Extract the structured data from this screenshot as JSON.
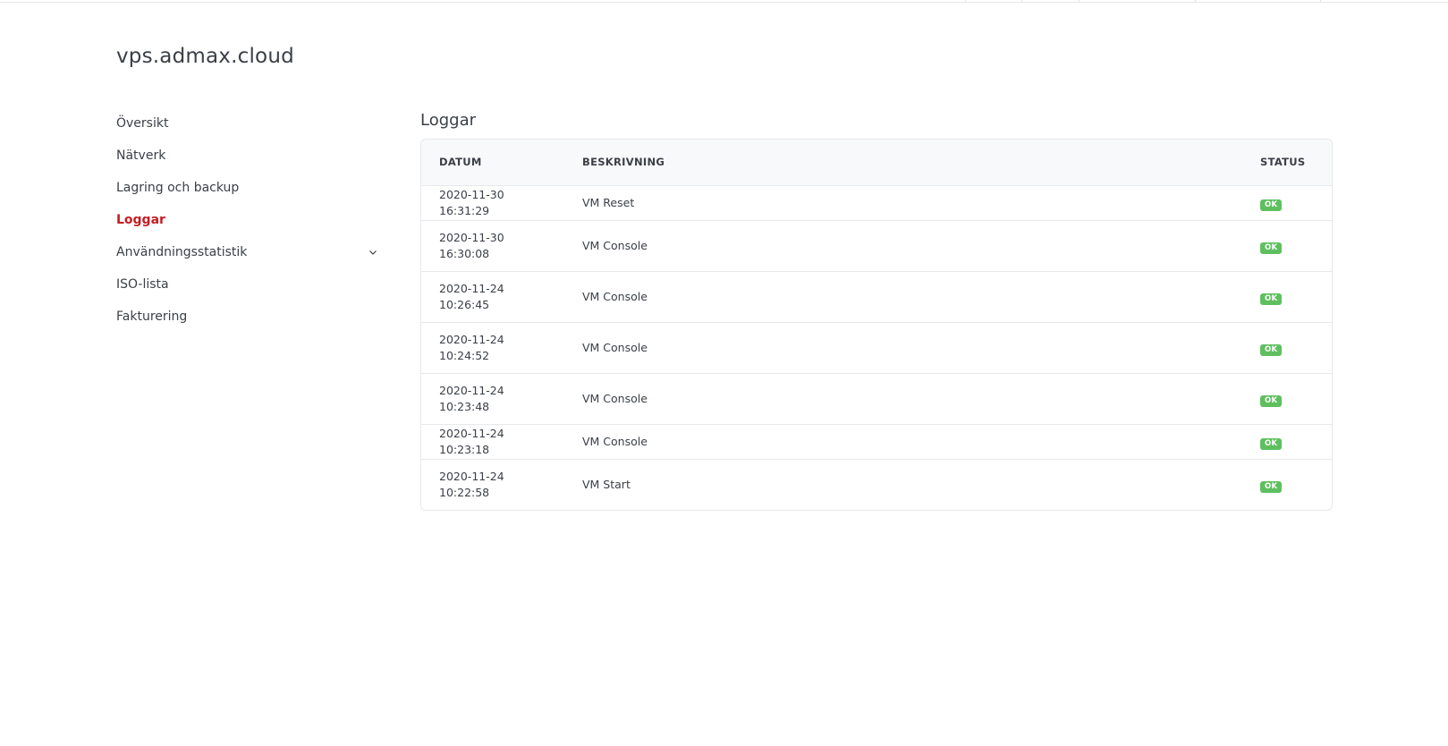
{
  "site": {
    "title": "vps.admax.cloud"
  },
  "sidebar": {
    "items": [
      {
        "label": "Översikt"
      },
      {
        "label": "Nätverk"
      },
      {
        "label": "Lagring och backup"
      },
      {
        "label": "Loggar",
        "active": true
      },
      {
        "label": "Användningsstatistik",
        "expandable": true,
        "icon": "chevron-down-icon"
      },
      {
        "label": "ISO-lista"
      },
      {
        "label": "Fakturering"
      }
    ]
  },
  "logs": {
    "title": "Loggar",
    "columns": {
      "date": "DATUM",
      "description": "BESKRIVNING",
      "status": "STATUS"
    },
    "rows": [
      {
        "date": "2020-11-30 16:31:29",
        "description": "VM Reset",
        "status": "OK"
      },
      {
        "date": "2020-11-30 16:30:08",
        "description": "VM Console",
        "status": "OK"
      },
      {
        "date": "2020-11-24 10:26:45",
        "description": "VM Console",
        "status": "OK"
      },
      {
        "date": "2020-11-24 10:24:52",
        "description": "VM Console",
        "status": "OK"
      },
      {
        "date": "2020-11-24 10:23:48",
        "description": "VM Console",
        "status": "OK"
      },
      {
        "date": "2020-11-24 10:23:18",
        "description": "VM Console",
        "status": "OK"
      },
      {
        "date": "2020-11-24 10:22:58",
        "description": "VM Start",
        "status": "OK"
      }
    ]
  },
  "colors": {
    "accent": "#c41e24",
    "ok_badge": "#5fbf5f",
    "text": "#3a3f47",
    "border": "#e6e8eb",
    "header_bg": "#f8f9fa"
  }
}
